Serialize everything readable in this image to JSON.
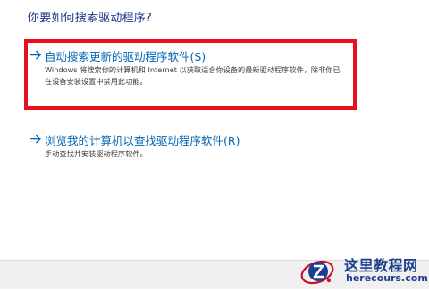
{
  "dialog": {
    "heading": "你要如何搜索驱动程序?",
    "options": [
      {
        "title": "自动搜索更新的驱动程序软件(S)",
        "description": "Windows 将搜索你的计算机和 Internet 以获取适合你设备的最新驱动程序软件，除非你已在设备安装设置中禁用此功能。",
        "icon": "arrow-right-icon"
      },
      {
        "title": "浏览我的计算机以查找驱动程序软件(R)",
        "description": "手动查找并安装驱动程序软件。",
        "icon": "arrow-right-icon"
      }
    ]
  },
  "watermark": {
    "name": "这里教程网",
    "domain": "herecours.com"
  },
  "colors": {
    "heading": "#1e3287",
    "link": "#0066b4",
    "highlight": "#e8101e",
    "footer": "#f0f0f0"
  }
}
